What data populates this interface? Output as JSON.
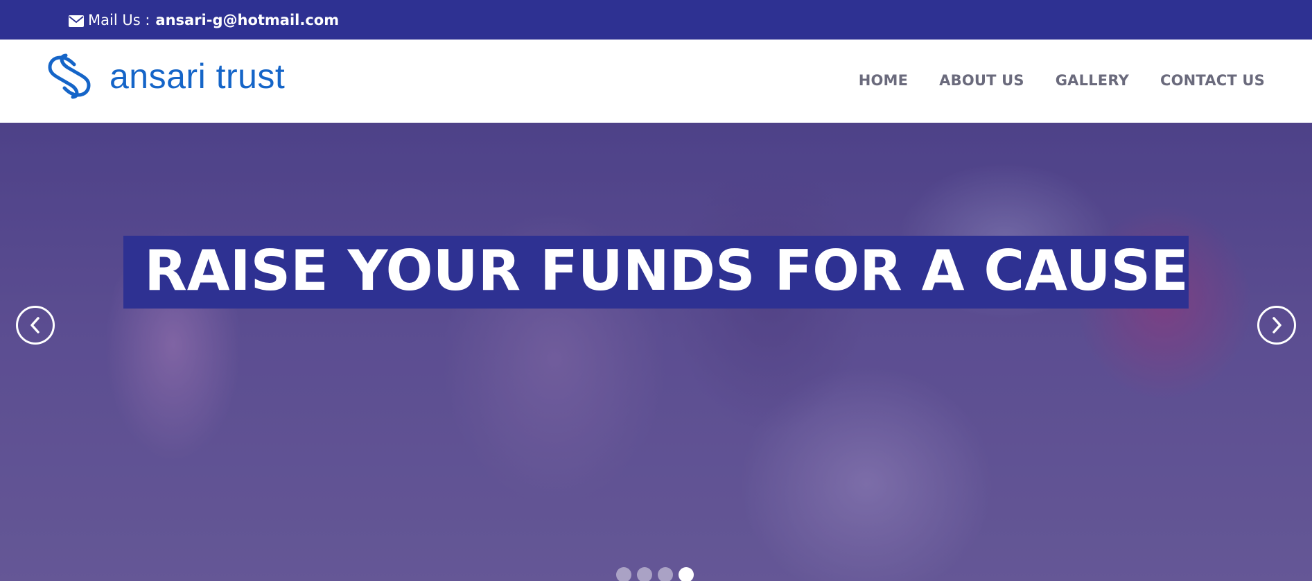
{
  "topbar": {
    "mail_icon": "envelope-icon",
    "mail_label": "Mail Us :",
    "mail_address": "ansari-g@hotmail.com",
    "background": "#2e3192"
  },
  "header": {
    "brand": {
      "logo_icon": "interlinked-loops-logo",
      "name": "ansari trust",
      "color": "#1565c8"
    },
    "nav": [
      {
        "label": "HOME"
      },
      {
        "label": "ABOUT US"
      },
      {
        "label": "GALLERY"
      },
      {
        "label": "CONTACT US"
      }
    ]
  },
  "hero": {
    "title": "RAISE YOUR FUNDS FOR A CAUSE",
    "prev_icon": "chevron-left-icon",
    "next_icon": "chevron-right-icon",
    "slide_count": 4,
    "active_slide": 4,
    "highlight_color": "#2e3192"
  }
}
